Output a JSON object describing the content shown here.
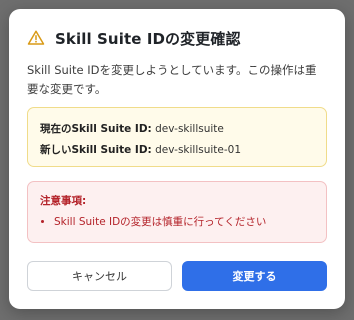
{
  "dialog": {
    "title": "Skill Suite IDの変更確認",
    "description": "Skill Suite IDを変更しようとしています。この操作は重要な変更です。",
    "current_label": "現在のSkill Suite ID:",
    "current_value": "dev-skillsuite",
    "new_label": "新しいSkill Suite ID:",
    "new_value": "dev-skillsuite-01",
    "notice_heading": "注意事項:",
    "notice_items": [
      "Skill Suite IDの変更は慎重に行ってください"
    ],
    "cancel_label": "キャンセル",
    "confirm_label": "変更する"
  },
  "icons": {
    "title_icon": "warning-triangle-icon"
  },
  "colors": {
    "accent": "#2f6fe8",
    "warning": "#d99a16",
    "danger": "#b4232a"
  }
}
